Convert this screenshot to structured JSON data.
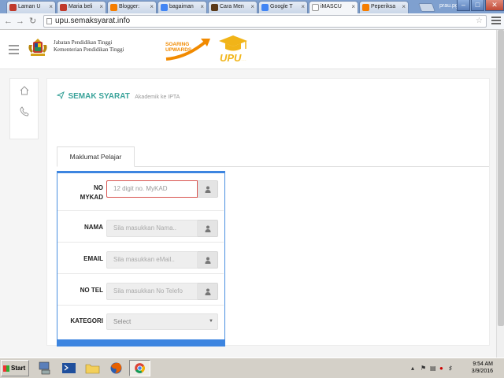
{
  "browser": {
    "tabs": [
      {
        "label": "Laman U",
        "favicon_color": "#c0392b"
      },
      {
        "label": "Maria beli",
        "favicon_color": "#c0392b"
      },
      {
        "label": "Blogger:",
        "favicon_color": "#f57d00"
      },
      {
        "label": "bagaiman",
        "favicon_color": "#4285f4"
      },
      {
        "label": "Cara Men",
        "favicon_color": "#5b3a1a"
      },
      {
        "label": "Google T",
        "favicon_color": "#4285f4"
      },
      {
        "label": "iMASCU",
        "favicon_color": "#ffffff"
      },
      {
        "label": "Peperiksa",
        "favicon_color": "#f57d00"
      }
    ],
    "active_tab_index": 6,
    "profile_name": "prau.pg",
    "window_controls": {
      "minimize": "–",
      "maximize": "□",
      "close": "✕"
    },
    "url": "upu.semaksyarat.info",
    "back_icon": "back-arrow-icon",
    "forward_icon": "forward-arrow-icon",
    "reload_icon": "reload-icon"
  },
  "header": {
    "org_line1": "Jabatan Pendidikan Tinggi",
    "org_line2": "Kementerian Pendidikan Tinggi",
    "soaring_line1": "SOARING",
    "soaring_line2": "UPWARDS",
    "upu_logo": "UPU"
  },
  "sidemenu": {
    "items": [
      {
        "icon": "home-icon"
      },
      {
        "icon": "phone-icon"
      }
    ]
  },
  "main": {
    "title": "SEMAK SYARAT",
    "subtitle": "Akademik ke IPTA",
    "tab_label": "Maklumat Pelajar",
    "accent_color": "#3aa39a",
    "form": {
      "mykad_label_line1": "NO",
      "mykad_label_line2": "MYKAD",
      "mykad_placeholder": "12 digit no. MyKAD",
      "nama_label": "NAMA",
      "nama_placeholder": "Sila masukkan Nama..",
      "email_label": "EMAIL",
      "email_placeholder": "Sila masukkan eMail..",
      "notel_label": "NO TEL",
      "notel_placeholder": "Sila masukkan No Telefo",
      "kategori_label": "KATEGORI",
      "kategori_value": "Select",
      "addon_icon": "user-icon",
      "border_color": "#3d85e0",
      "error_border_color": "#d9534f"
    }
  },
  "taskbar": {
    "start_label": "Start",
    "apps": [
      "network-icon",
      "powershell-icon",
      "folder-icon",
      "firefox-icon",
      "chrome-icon"
    ],
    "clock_time": "9:54 AM",
    "clock_date": "3/9/2016"
  }
}
